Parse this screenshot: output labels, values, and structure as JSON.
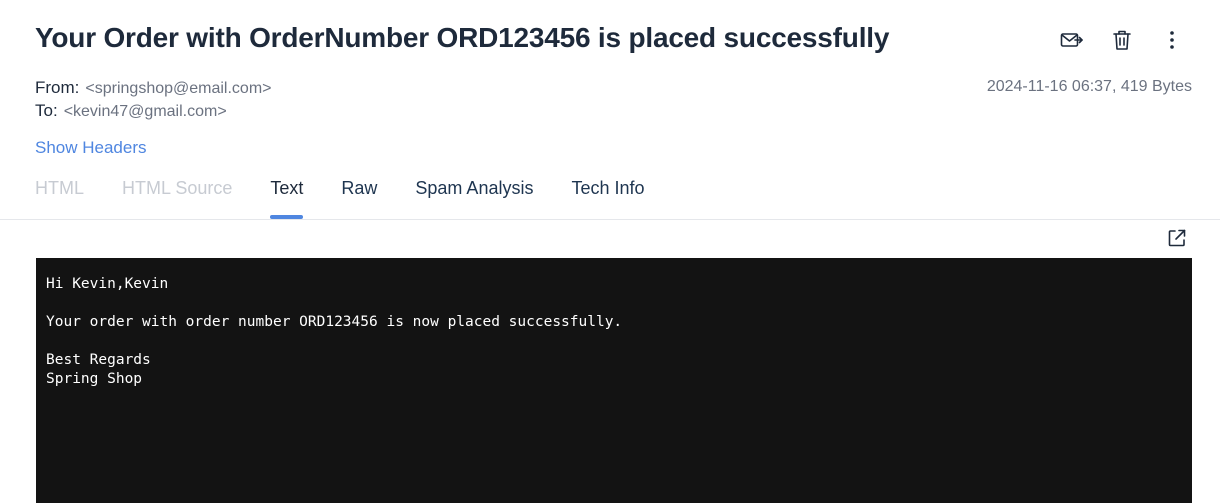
{
  "message": {
    "subject": "Your Order with OrderNumber ORD123456 is placed successfully",
    "from_label": "From:",
    "from_address": "<springshop@email.com>",
    "to_label": "To:",
    "to_address": "<kevin47@gmail.com>",
    "timestamp": "2024-11-16 06:37, 419 Bytes",
    "show_headers": "Show Headers",
    "body_text": "Hi Kevin,Kevin\n\nYour order with order number ORD123456 is now placed successfully.\n\nBest Regards\nSpring Shop"
  },
  "actions": {
    "icons": [
      "forward-mail-icon",
      "trash-icon",
      "more-vertical-icon"
    ]
  },
  "tabs": [
    {
      "label": "HTML",
      "state": "disabled"
    },
    {
      "label": "HTML Source",
      "state": "disabled"
    },
    {
      "label": "Text",
      "state": "active"
    },
    {
      "label": "Raw",
      "state": "normal"
    },
    {
      "label": "Spam Analysis",
      "state": "normal"
    },
    {
      "label": "Tech Info",
      "state": "normal"
    }
  ],
  "colors": {
    "accent": "#4f86e0",
    "text": "#1e2a3b",
    "muted": "#6b7280",
    "disabled": "#c7cbd2",
    "panel_bg": "#131313"
  }
}
